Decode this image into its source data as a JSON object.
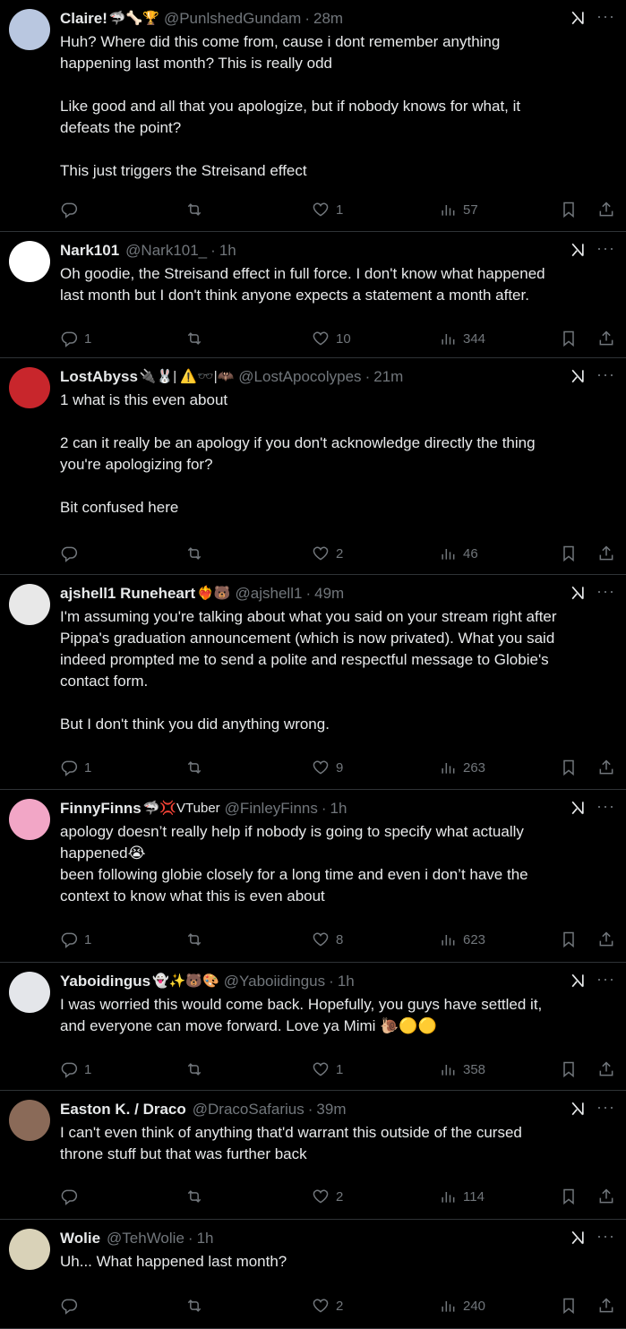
{
  "posts": [
    {
      "name": "Claire!",
      "emoji": "🦈🦴🏆",
      "handle": "@PunlshedGundam",
      "time": "28m",
      "lines": [
        "Huh? Where did this come from, cause i dont remember anything",
        "happening last month? This is really odd",
        "",
        "Like good and all that you apologize, but if nobody knows for what, it",
        "defeats the point?",
        "",
        "This just triggers the Streisand effect"
      ],
      "replies": "",
      "retweets": "",
      "likes": "1",
      "views": "57",
      "avatar_color": "#b9c7e0"
    },
    {
      "name": "Nark101",
      "emoji": "",
      "handle": "@Nark101_",
      "time": "1h",
      "lines": [
        "Oh goodie, the Streisand effect in full force. I don't know what happened",
        "last month but I don't think anyone expects a statement a month after."
      ],
      "replies": "1",
      "retweets": "",
      "likes": "10",
      "views": "344",
      "avatar_color": "#ffffff"
    },
    {
      "name": "LostAbyss",
      "emoji": "🔌🐰| ⚠️🕶️|🦇",
      "handle": "@LostApocolypes",
      "time": "21m",
      "lines": [
        "1 what is this even about",
        "",
        "2 can it really be an apology if you don't acknowledge directly the thing",
        "you're apologizing for?",
        "",
        "Bit confused here"
      ],
      "replies": "",
      "retweets": "",
      "likes": "2",
      "views": "46",
      "avatar_color": "#c8262c"
    },
    {
      "name": "ajshell1 Runeheart",
      "emoji": "❤️‍🔥🐻",
      "handle": "@ajshell1",
      "time": "49m",
      "lines": [
        "I'm assuming you're talking about what you said on your stream right after",
        "Pippa's graduation announcement (which is now privated). What you said",
        "indeed prompted me to send a polite and respectful message to Globie's",
        "contact form.",
        "",
        "But I don't think you did anything wrong."
      ],
      "replies": "1",
      "retweets": "",
      "likes": "9",
      "views": "263",
      "avatar_color": "#e8e8e8"
    },
    {
      "name": "FinnyFinns",
      "emoji": "🦈💢VTuber",
      "handle": "@FinleyFinns",
      "time": "1h",
      "lines": [
        "apology doesn’t really help if nobody is going to specify what actually",
        "happened😭",
        "been following globie closely for a long time and even i don’t have the",
        "context to know what this is even about"
      ],
      "replies": "1",
      "retweets": "",
      "likes": "8",
      "views": "623",
      "avatar_color": "#f2a6c6"
    },
    {
      "name": "Yaboidingus",
      "emoji": "👻✨🐻🎨",
      "handle": "@Yaboiidingus",
      "time": "1h",
      "lines": [
        "I was worried this would come back. Hopefully, you guys have settled it,",
        "and everyone can move forward. Love ya Mimi 🐌🟡🟡"
      ],
      "replies": "1",
      "retweets": "",
      "likes": "1",
      "views": "358",
      "avatar_color": "#e4e6ea"
    },
    {
      "name": "Easton K. / Draco",
      "emoji": "",
      "handle": "@DracoSafarius",
      "time": "39m",
      "lines": [
        "I can't even think of anything that'd warrant this outside of the cursed",
        "throne stuff but that was further back"
      ],
      "replies": "",
      "retweets": "",
      "likes": "2",
      "views": "114",
      "avatar_color": "#8a6a58"
    },
    {
      "name": "Wolie",
      "emoji": "",
      "handle": "@TehWolie",
      "time": "1h",
      "lines": [
        "Uh... What happened last month?"
      ],
      "replies": "",
      "retweets": "",
      "likes": "2",
      "views": "240",
      "avatar_color": "#d9d2b8"
    }
  ]
}
